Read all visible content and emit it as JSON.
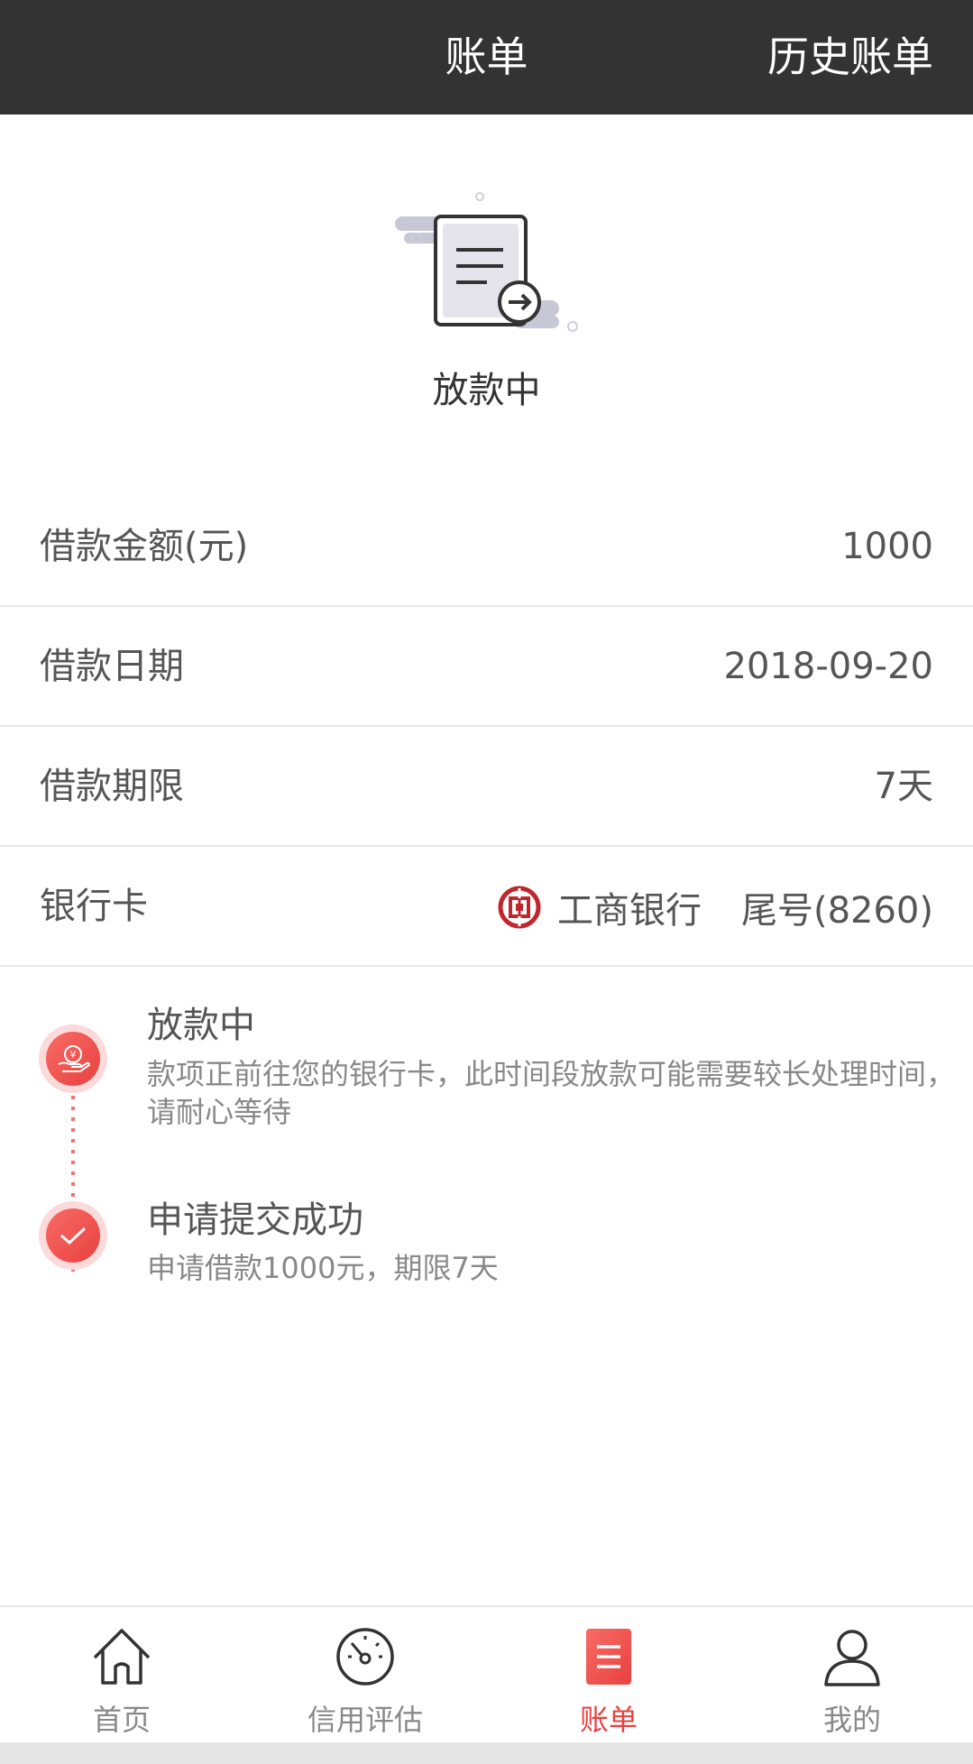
{
  "header": {
    "title": "账单",
    "history_label": "历史账单"
  },
  "status": {
    "icon": "document-arrow-icon",
    "title": "放款中"
  },
  "details": [
    {
      "label": "借款金额(元)",
      "value": "1000"
    },
    {
      "label": "借款日期",
      "value": "2018-09-20"
    },
    {
      "label": "借款期限",
      "value": "7天"
    }
  ],
  "bank": {
    "label": "银行卡",
    "icon": "icbc-logo-icon",
    "name": "工商银行",
    "tail": "尾号(8260)"
  },
  "timeline": [
    {
      "icon": "yen-hand-icon",
      "title": "放款中",
      "desc": "款项正前往您的银行卡，此时间段放款可能需要较长处理时间，请耐心等待"
    },
    {
      "icon": "check-icon",
      "title": "申请提交成功",
      "desc": "申请借款1000元，期限7天"
    }
  ],
  "tabs": [
    {
      "label": "首页",
      "icon": "home-icon"
    },
    {
      "label": "信用评估",
      "icon": "gauge-icon"
    },
    {
      "label": "账单",
      "icon": "bill-icon",
      "active": true
    },
    {
      "label": "我的",
      "icon": "user-icon"
    }
  ],
  "colors": {
    "accent": "#e8413e",
    "topbar": "#333333"
  }
}
